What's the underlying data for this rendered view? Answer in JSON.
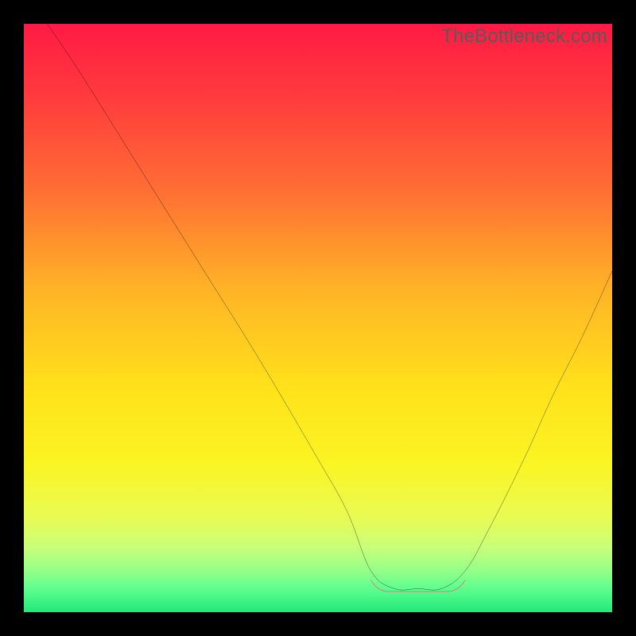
{
  "watermark": {
    "text": "TheBottleneck.com"
  },
  "gradient": {
    "stops": [
      {
        "pct": 0,
        "color": "#ff1a44"
      },
      {
        "pct": 12,
        "color": "#ff3a3d"
      },
      {
        "pct": 28,
        "color": "#ff6d34"
      },
      {
        "pct": 45,
        "color": "#ffb326"
      },
      {
        "pct": 62,
        "color": "#ffe21a"
      },
      {
        "pct": 75,
        "color": "#faf524"
      },
      {
        "pct": 84,
        "color": "#e8fb55"
      },
      {
        "pct": 89,
        "color": "#c8ff7a"
      },
      {
        "pct": 93,
        "color": "#93ff89"
      },
      {
        "pct": 96,
        "color": "#5dff8f"
      },
      {
        "pct": 100,
        "color": "#22e87b"
      }
    ]
  },
  "optimum_band": {
    "y": 96,
    "x_start": 59,
    "x_end": 75,
    "color": "#d87a72",
    "thickness": 2
  },
  "chart_data": {
    "type": "line",
    "title": "",
    "xlabel": "",
    "ylabel": "",
    "xlim": [
      0,
      100
    ],
    "ylim": [
      0,
      100
    ],
    "grid": false,
    "series": [
      {
        "name": "bottleneck-curve",
        "x": [
          4,
          10,
          20,
          30,
          40,
          50,
          55,
          59,
          63,
          67,
          71,
          75,
          79,
          85,
          90,
          95,
          100
        ],
        "y": [
          0,
          9,
          25,
          41,
          57,
          74,
          83,
          93,
          96,
          96,
          96,
          93,
          86,
          74,
          63,
          53,
          42
        ]
      }
    ],
    "annotations": [
      {
        "name": "optimum-range",
        "x_start": 59,
        "x_end": 75,
        "y": 96,
        "note": "flat bottom region marked in muted red"
      }
    ]
  }
}
